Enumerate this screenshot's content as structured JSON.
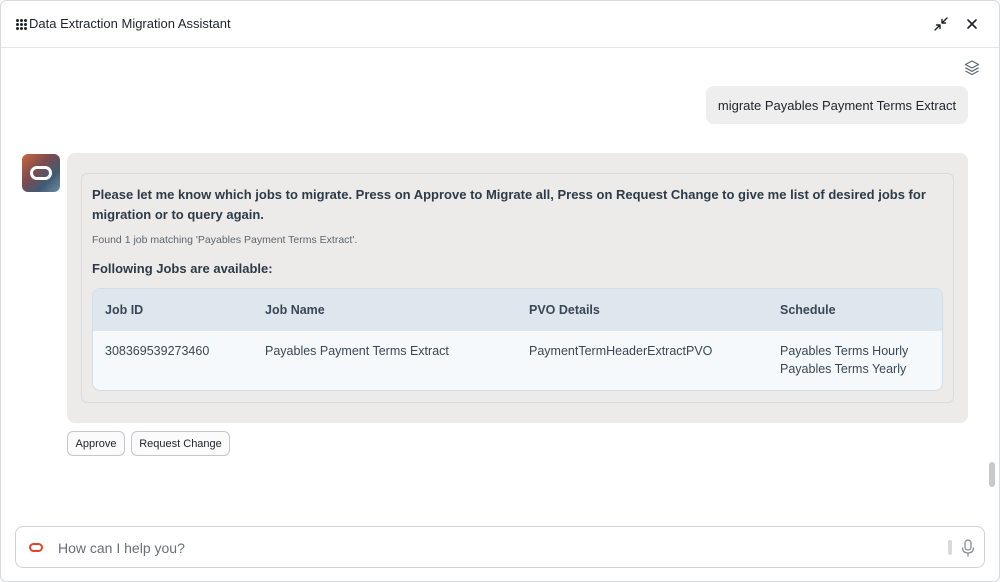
{
  "header": {
    "title": "Data Extraction Migration Assistant"
  },
  "conversation": {
    "user_message": "migrate Payables Payment Terms Extract",
    "bot_message": {
      "instruction": "Please let me know which jobs to migrate. Press on Approve to Migrate all, Press on Request Change to give me list of desired jobs for migration or to query again.",
      "found_text": "Found 1 job matching 'Payables Payment Terms Extract'.",
      "following_text": "Following Jobs are available:",
      "table": {
        "headers": [
          "Job ID",
          "Job Name",
          "PVO Details",
          "Schedule"
        ],
        "rows": [
          {
            "job_id": "308369539273460",
            "job_name": "Payables Payment Terms Extract",
            "pvo_details": "PaymentTermHeaderExtractPVO",
            "schedule": [
              "Payables Terms Hourly",
              "Payables Terms Yearly"
            ]
          }
        ]
      }
    },
    "actions": {
      "approve_label": "Approve",
      "request_change_label": "Request Change"
    }
  },
  "input": {
    "placeholder": "How can I help you?",
    "value": ""
  },
  "icons": {
    "app": "app-grid-icon",
    "minimize": "minimize-icon",
    "close": "close-icon",
    "layers": "layers-icon",
    "avatar": "oracle-logo-icon",
    "input_logo": "oracle-logo-icon",
    "mic": "microphone-icon"
  },
  "colors": {
    "brand_red": "#e0452a",
    "bot_bubble": "#ecebe9",
    "user_bubble": "#eeeeef",
    "table_header": "#dee6ee"
  }
}
